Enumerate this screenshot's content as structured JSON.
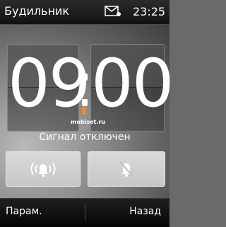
{
  "statusbar": {
    "title": "Будильник",
    "time": "23:25",
    "icons": [
      "mail-icon"
    ]
  },
  "alarm": {
    "hours": "09",
    "minutes": "00",
    "status": "Сигнал отключен"
  },
  "watermark": "mobiset.ru",
  "buttons": {
    "left_icon": "alarm-sound-icon",
    "right_icon": "muted-bell-icon"
  },
  "softkeys": {
    "left": "Парам.",
    "right": "Назад"
  }
}
